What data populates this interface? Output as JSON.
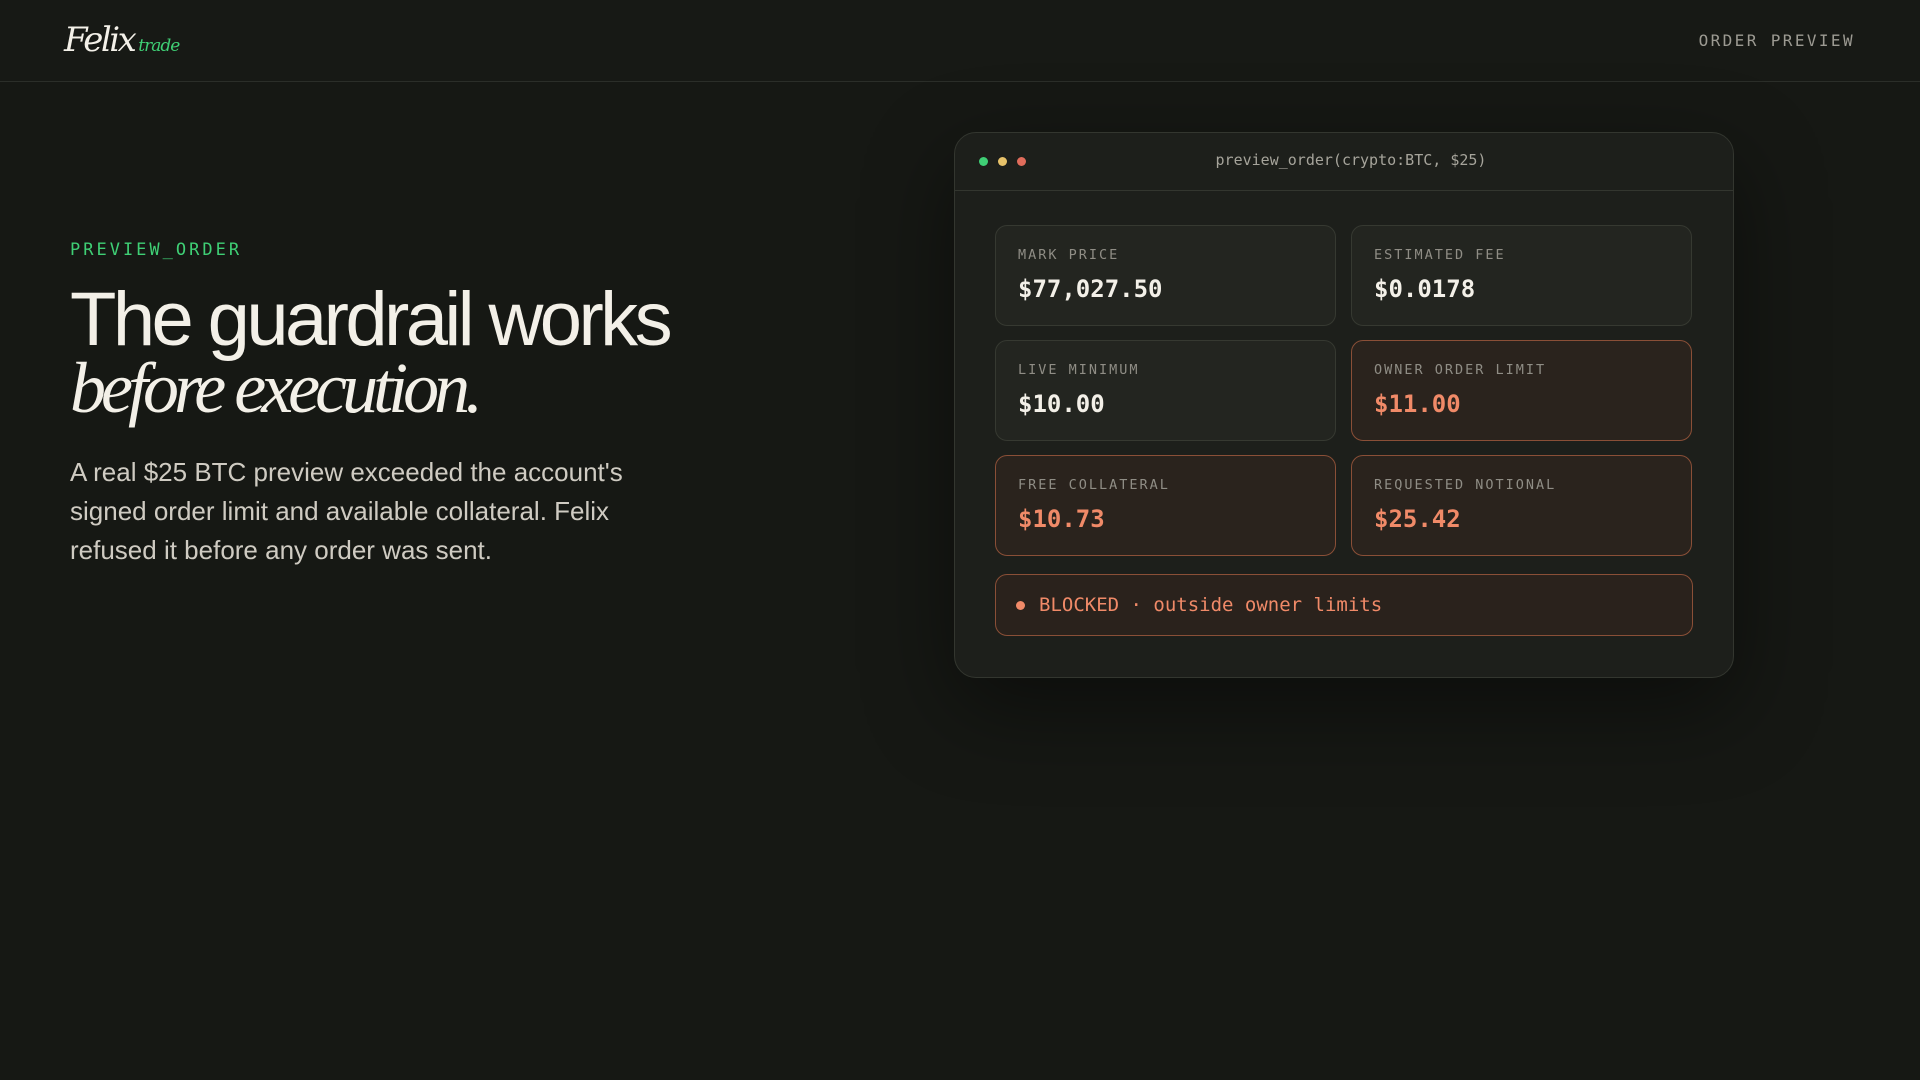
{
  "header": {
    "logo_main": "Felix",
    "logo_sub": "trade",
    "nav_label": "ORDER PREVIEW"
  },
  "hero": {
    "eyebrow": "PREVIEW_ORDER",
    "headline": "The guardrail works",
    "headline_italic": "before execution.",
    "body": "A real $25 BTC preview exceeded the account's signed order limit and available collateral. Felix refused it before any order was sent."
  },
  "panel": {
    "title": "preview_order(crypto:BTC, $25)",
    "window_dots": [
      "green",
      "yellow",
      "red"
    ],
    "cards": [
      {
        "label": "MARK PRICE",
        "value": "$77,027.50",
        "state": "normal"
      },
      {
        "label": "ESTIMATED FEE",
        "value": "$0.0178",
        "state": "normal"
      },
      {
        "label": "LIVE MINIMUM",
        "value": "$10.00",
        "state": "normal"
      },
      {
        "label": "OWNER ORDER LIMIT",
        "value": "$11.00",
        "state": "warn"
      },
      {
        "label": "FREE COLLATERAL",
        "value": "$10.73",
        "state": "warn"
      },
      {
        "label": "REQUESTED NOTIONAL",
        "value": "$25.42",
        "state": "warn"
      }
    ],
    "status": "BLOCKED · outside owner limits"
  },
  "colors": {
    "background": "#161814",
    "accent_green": "#3fcf75",
    "warning": "#f08a68",
    "text": "#f3f0e8"
  }
}
